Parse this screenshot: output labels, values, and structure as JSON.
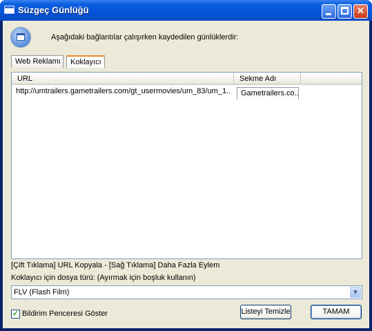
{
  "window": {
    "title": "Süzgeç Günlüğü"
  },
  "header": {
    "text": "Aşağıdaki bağlantılar çalışırken kaydedilen günlüklerdir:",
    "icon": "filter-log-icon"
  },
  "tabs": [
    {
      "label": "Web Reklamı",
      "selected": false
    },
    {
      "label": "Koklayıcı",
      "selected": true
    }
  ],
  "table": {
    "columns": [
      "URL",
      "Sekme Adı"
    ],
    "rows": [
      {
        "url": "http://umtrailers.gametrailers.com/gt_usermovies/um_83/um_1...",
        "tab": "Gametrailers.co..."
      }
    ]
  },
  "hint": "[Çift Tıklama] URL Kopyala - [Sağ Tıklama] Daha Fazla Eylem",
  "filetype": {
    "label": "Koklayıcı için dosya türü: (Ayırmak için boşluk kullanın)",
    "selected": "FLV (Flash Film)"
  },
  "notify": {
    "label": "Bildirim Penceresi Göster",
    "checked": true
  },
  "buttons": {
    "clear": "Listeyi Temizle",
    "ok": "TAMAM"
  }
}
